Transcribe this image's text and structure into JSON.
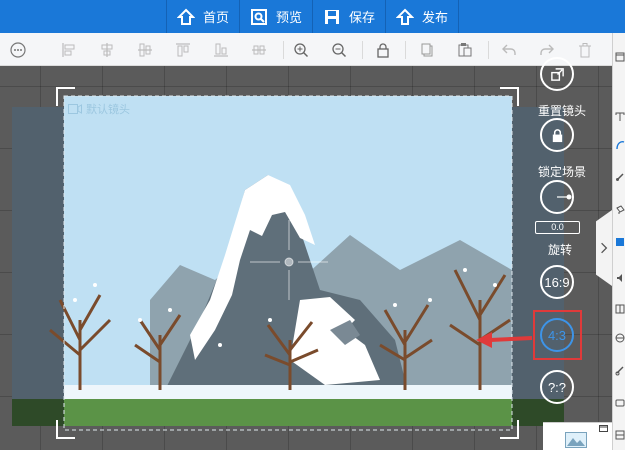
{
  "topbar": {
    "home": "首页",
    "preview": "预览",
    "save": "保存",
    "publish": "发布"
  },
  "camera": {
    "label": "默认镜头"
  },
  "controls": {
    "reset_camera": "重置镜头",
    "lock_scene": "锁定场景",
    "rotate_value": "0.0",
    "rotate": "旋转",
    "ratio_16_9": "16:9",
    "ratio_4_3": "4:3",
    "ratio_custom": "?:?"
  },
  "colors": {
    "topbar": "#1a78d8",
    "active_ratio": "#3d94e8",
    "highlight": "#e03a3a",
    "sky": "#bfe0f3",
    "grass": "#5b9347"
  }
}
